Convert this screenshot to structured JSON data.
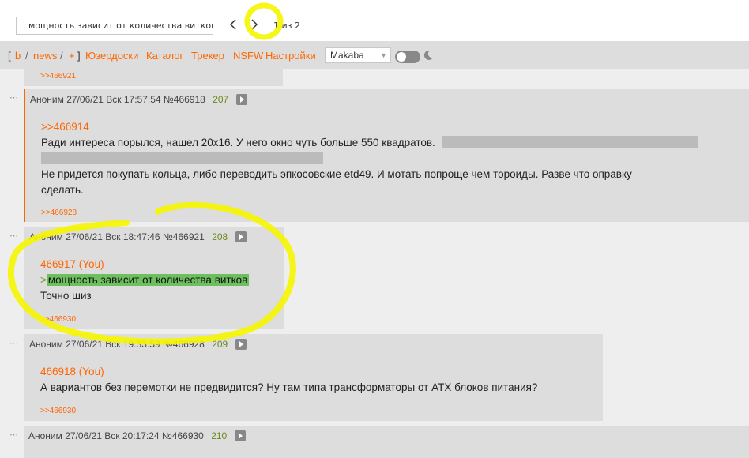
{
  "findbar": {
    "query": "мощность зависит от количества витков",
    "count": "1 из 2"
  },
  "nav": {
    "open_bracket": "[",
    "close_bracket": "]",
    "links": [
      "b",
      "news",
      "+"
    ],
    "separator": "/",
    "menu": [
      "Юзердоски",
      "Каталог",
      "Трекер",
      "NSFW",
      "Настройки"
    ],
    "style_select": "Makaba"
  },
  "colors": {
    "accent": "#ff6600",
    "post_bg": "#dddddd",
    "page_bg": "#eeeeee",
    "quote_highlight": "#6dbf5f",
    "annotation": "#f5f500"
  },
  "posts": [
    {
      "backref": ">>466921"
    },
    {
      "author": "Аноним",
      "datetime": "27/06/21 Вск 17:57:54",
      "id": "№466918",
      "ordinal": "207",
      "reply": ">>466914",
      "lines": [
        "Ради интереса порылся, нашел 20x16. У него окно чуть больше 550 квадратов.",
        "Не придется покупать кольца, либо переводить эпкосовские etd49. И мотать попроще чем тороиды. Разве что оправку",
        "сделать."
      ],
      "backref": ">>466928"
    },
    {
      "author": "Аноним",
      "datetime": "27/06/21 Вск 18:47:46",
      "id": "№466921",
      "ordinal": "208",
      "reply": "466917 (You)",
      "quote_gt": ">",
      "quote": "мощность зависит от количества витков",
      "text": "Точно шиз",
      "backref": ">>466930"
    },
    {
      "author": "Аноним",
      "datetime": "27/06/21 Вск 19:33:59",
      "id": "№466928",
      "ordinal": "209",
      "reply": "466918 (You)",
      "text": "А вариантов без перемотки не предвидится? Ну там типа трансформаторы от ATX блоков питания?",
      "backref": ">>466930"
    },
    {
      "author": "Аноним",
      "datetime": "27/06/21 Вск 20:17:24",
      "id": "№466930",
      "ordinal": "210"
    }
  ]
}
